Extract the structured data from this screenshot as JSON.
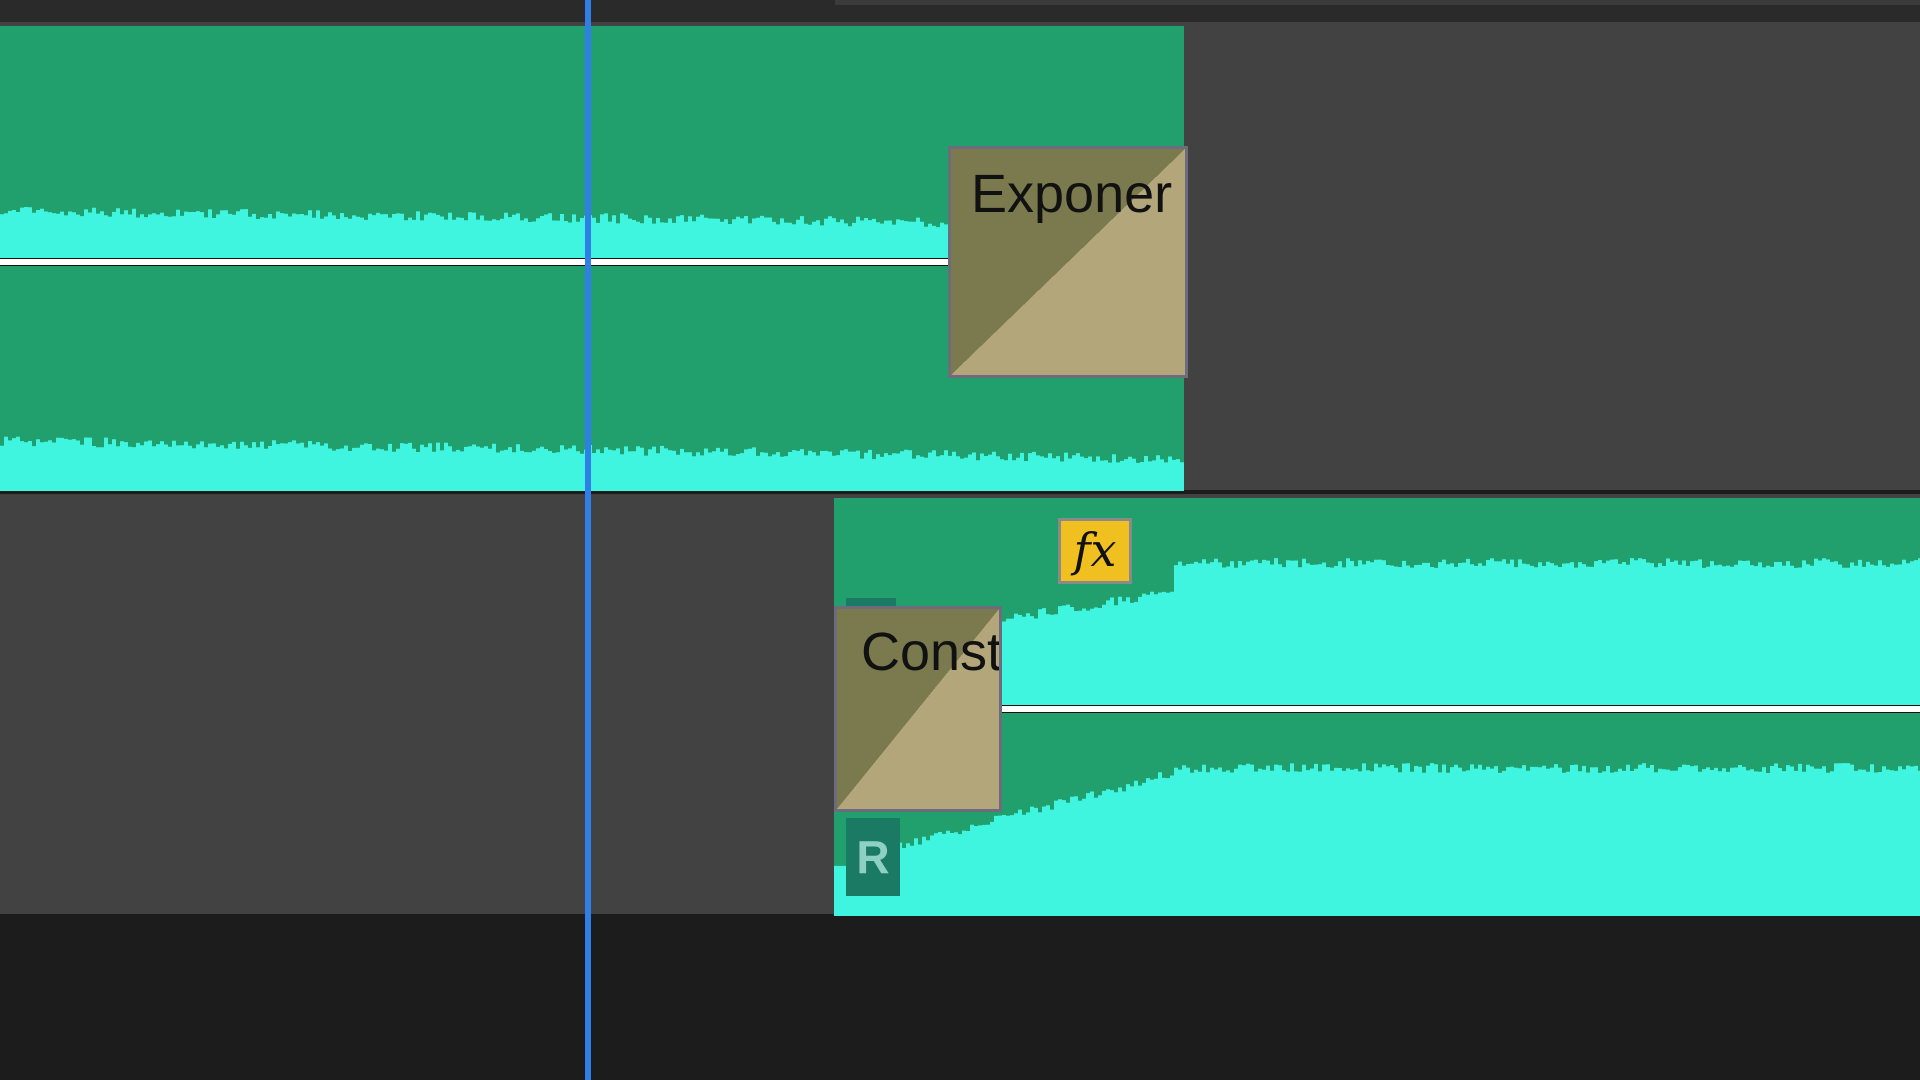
{
  "timeline": {
    "tracks": [
      {
        "clip": {
          "color": "#21a06e",
          "waveform_color": "#3ff5e0",
          "transition": {
            "label": "Exponer",
            "type": "Exponential Fade"
          }
        }
      },
      {
        "clip": {
          "color": "#21a06e",
          "waveform_color": "#3ff5e0",
          "transition": {
            "label": "Const",
            "type": "Constant Power"
          },
          "fx_badge": "fx",
          "r_badge": "R"
        }
      }
    ],
    "playhead_color": "#2f7fe6"
  }
}
